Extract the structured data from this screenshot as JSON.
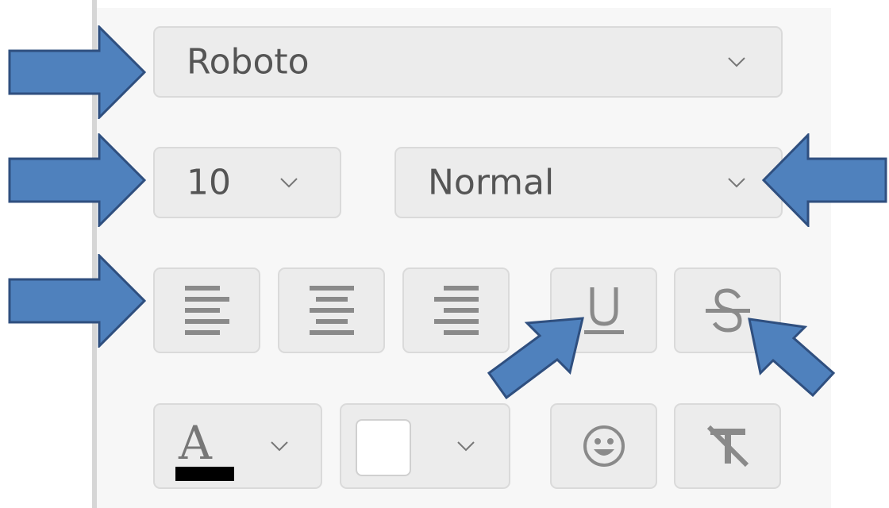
{
  "font_selector": {
    "value": "Roboto",
    "icon": "chevron-down-icon"
  },
  "size_selector": {
    "value": "10",
    "icon": "chevron-down-icon"
  },
  "style_selector": {
    "value": "Normal",
    "icon": "chevron-down-icon"
  },
  "alignment": {
    "buttons": [
      {
        "name": "align-left",
        "icon": "align-left-icon"
      },
      {
        "name": "align-center",
        "icon": "align-center-icon"
      },
      {
        "name": "align-right",
        "icon": "align-right-icon"
      }
    ]
  },
  "format_buttons": [
    {
      "name": "underline",
      "icon": "underline-icon"
    },
    {
      "name": "strikethrough",
      "icon": "strikethrough-icon"
    }
  ],
  "text_color": {
    "glyph": "A",
    "swatch_color": "#000000",
    "icon": "chevron-down-icon"
  },
  "background_color": {
    "swatch_color": "#ffffff",
    "icon": "chevron-down-icon"
  },
  "emoji": {
    "icon": "smiley-icon"
  },
  "clear_format": {
    "icon": "clear-format-icon"
  },
  "annotation_arrows": {
    "color": "#4f81bd",
    "outline": "#2f4f7f",
    "count": 6
  }
}
